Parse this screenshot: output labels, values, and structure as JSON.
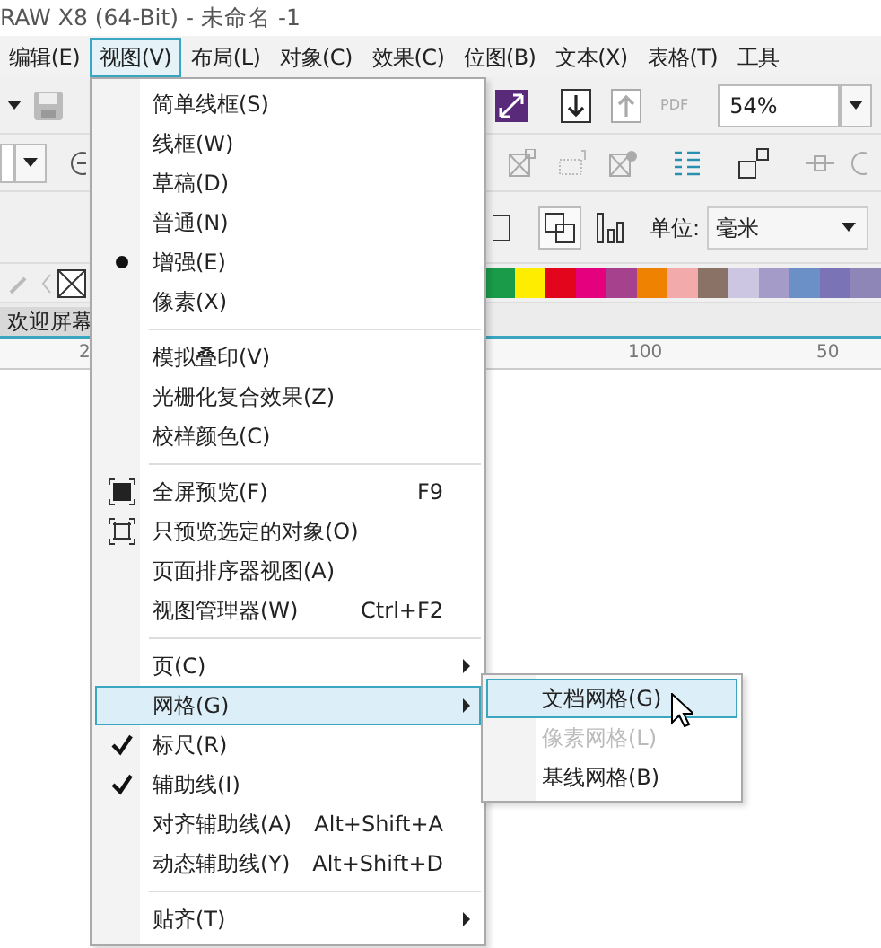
{
  "title_bar": {
    "title": "RAW X8 (64-Bit) - 未命名 -1"
  },
  "menu_bar": [
    {
      "label": "编辑(E)",
      "selected": false
    },
    {
      "label": "视图(V)",
      "selected": true
    },
    {
      "label": "布局(L)",
      "selected": false
    },
    {
      "label": "对象(C)",
      "selected": false
    },
    {
      "label": "效果(C)",
      "selected": false
    },
    {
      "label": "位图(B)",
      "selected": false
    },
    {
      "label": "文本(X)",
      "selected": false
    },
    {
      "label": "表格(T)",
      "selected": false
    },
    {
      "label": "工具",
      "selected": false
    }
  ],
  "toolbar": {
    "pdf_label": "PDF",
    "zoom_value": "54%",
    "units_label": "单位:",
    "units_value": "毫米"
  },
  "palette": [
    {
      "color": "#1a9b4a"
    },
    {
      "color": "#ffed00"
    },
    {
      "color": "#e3051b"
    },
    {
      "color": "#e5007e"
    },
    {
      "color": "#a5418d"
    },
    {
      "color": "#ef8200"
    },
    {
      "color": "#f2aaaa"
    },
    {
      "color": "#8a7266"
    },
    {
      "color": "#cdc6e2"
    },
    {
      "color": "#a59bc9"
    },
    {
      "color": "#6b8fc7"
    },
    {
      "color": "#7a73b5"
    },
    {
      "color": "#8f86b8"
    }
  ],
  "document_tab": "欢迎屏幕",
  "ruler": {
    "labels": [
      "2",
      "100",
      "50"
    ]
  },
  "view_menu": [
    {
      "kind": "plain",
      "label": "简单线框(S)",
      "selected": false
    },
    {
      "kind": "plain",
      "label": "线框(W)",
      "selected": false
    },
    {
      "kind": "plain",
      "label": "草稿(D)",
      "selected": false
    },
    {
      "kind": "plain",
      "label": "普通(N)",
      "selected": false
    },
    {
      "kind": "radio",
      "label": "增强(E)",
      "checked": true,
      "selected": false
    },
    {
      "kind": "plain",
      "label": "像素(X)",
      "selected": false
    },
    {
      "kind": "separator"
    },
    {
      "kind": "plain",
      "label": "模拟叠印(V)",
      "selected": false
    },
    {
      "kind": "plain",
      "label": "光栅化复合效果(Z)",
      "selected": false
    },
    {
      "kind": "plain",
      "label": "校样颜色(C)",
      "selected": false
    },
    {
      "kind": "separator"
    },
    {
      "kind": "fullscreen",
      "label": "全屏预览(F)",
      "shortcut": "F9",
      "selected": false
    },
    {
      "kind": "preview",
      "label": "只预览选定的对象(O)",
      "selected": false
    },
    {
      "kind": "plain",
      "label": "页面排序器视图(A)",
      "selected": false
    },
    {
      "kind": "plain",
      "label": "视图管理器(W)",
      "shortcut": "Ctrl+F2",
      "selected": false
    },
    {
      "kind": "separator"
    },
    {
      "kind": "submenu",
      "label": "页(C)",
      "selected": false
    },
    {
      "kind": "submenu",
      "label": "网格(G)",
      "selected": true
    },
    {
      "kind": "check",
      "label": "标尺(R)",
      "checked": true,
      "selected": false
    },
    {
      "kind": "check",
      "label": "辅助线(I)",
      "checked": true,
      "selected": false
    },
    {
      "kind": "plain",
      "label": "对齐辅助线(A)",
      "shortcut": "Alt+Shift+A",
      "selected": false
    },
    {
      "kind": "plain",
      "label": "动态辅助线(Y)",
      "shortcut": "Alt+Shift+D",
      "selected": false
    },
    {
      "kind": "separator"
    },
    {
      "kind": "submenu",
      "label": "贴齐(T)",
      "selected": false
    }
  ],
  "grid_submenu": [
    {
      "label": "文档网格(G)",
      "disabled": false,
      "selected": true
    },
    {
      "label": "像素网格(L)",
      "disabled": true,
      "selected": false
    },
    {
      "label": "基线网格(B)",
      "disabled": false,
      "selected": false
    }
  ]
}
